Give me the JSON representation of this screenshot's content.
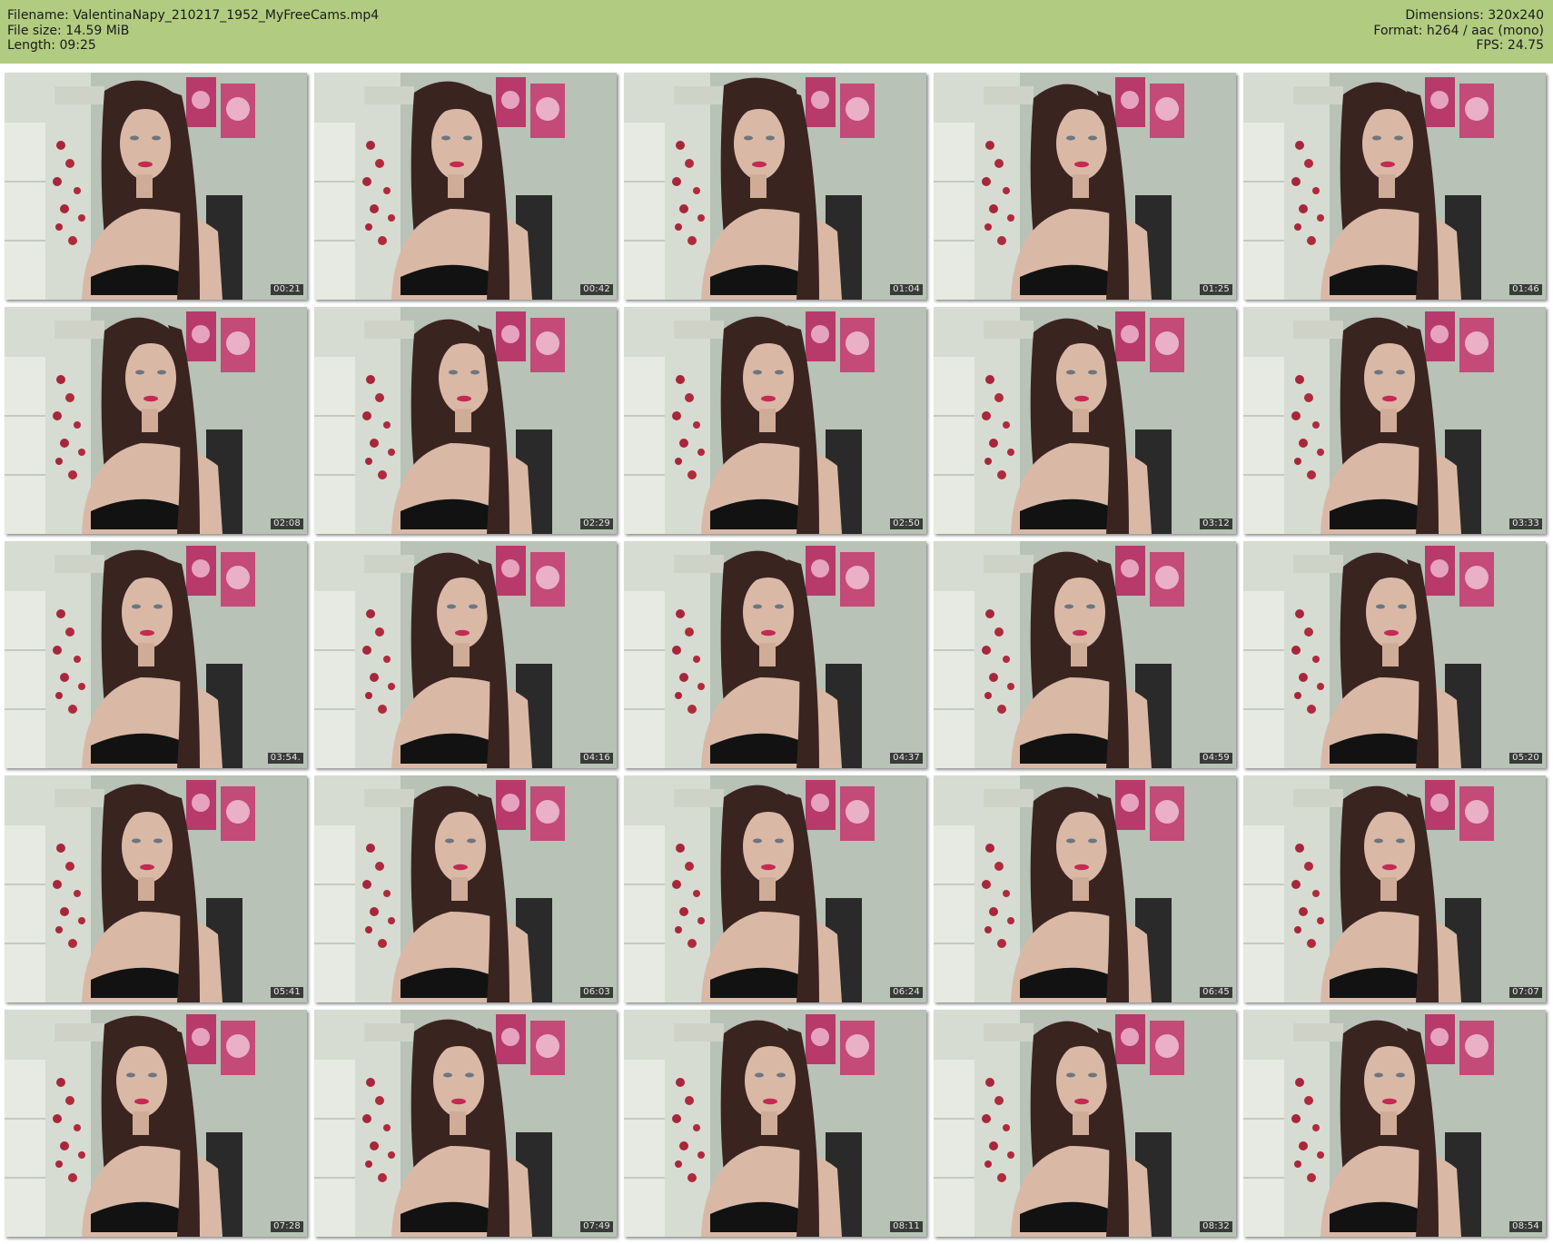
{
  "header": {
    "filename_label": "Filename:",
    "filename": "ValentinaNapy_210217_1952_MyFreeCams.mp4",
    "filesize_label": "File size:",
    "filesize": "14.59 MiB",
    "length_label": "Length:",
    "length": "09:25",
    "dimensions_label": "Dimensions:",
    "dimensions": "320x240",
    "format_label": "Format:",
    "format": "h264 / aac (mono)",
    "fps_label": "FPS:",
    "fps": "24.75"
  },
  "thumbnails": [
    {
      "timestamp": "00:21"
    },
    {
      "timestamp": "00:42"
    },
    {
      "timestamp": "01:04"
    },
    {
      "timestamp": "01:25"
    },
    {
      "timestamp": "01:46"
    },
    {
      "timestamp": "02:08"
    },
    {
      "timestamp": "02:29"
    },
    {
      "timestamp": "02:50"
    },
    {
      "timestamp": "03:12"
    },
    {
      "timestamp": "03:33"
    },
    {
      "timestamp": "03:54."
    },
    {
      "timestamp": "04:16"
    },
    {
      "timestamp": "04:37"
    },
    {
      "timestamp": "04:59"
    },
    {
      "timestamp": "05:20"
    },
    {
      "timestamp": "05:41"
    },
    {
      "timestamp": "06:03"
    },
    {
      "timestamp": "06:24"
    },
    {
      "timestamp": "06:45"
    },
    {
      "timestamp": "07:07"
    },
    {
      "timestamp": "07:28"
    },
    {
      "timestamp": "07:49"
    },
    {
      "timestamp": "08:11"
    },
    {
      "timestamp": "08:32"
    },
    {
      "timestamp": "08:54"
    }
  ],
  "colors": {
    "header_bg": "#b1cc80",
    "wall": "#b8c2b6",
    "hair": "#3a2420",
    "skin": "#d9b9a6",
    "bra": "#121212",
    "lips": "#c42a52",
    "flower_panel": "#b73a6a"
  }
}
